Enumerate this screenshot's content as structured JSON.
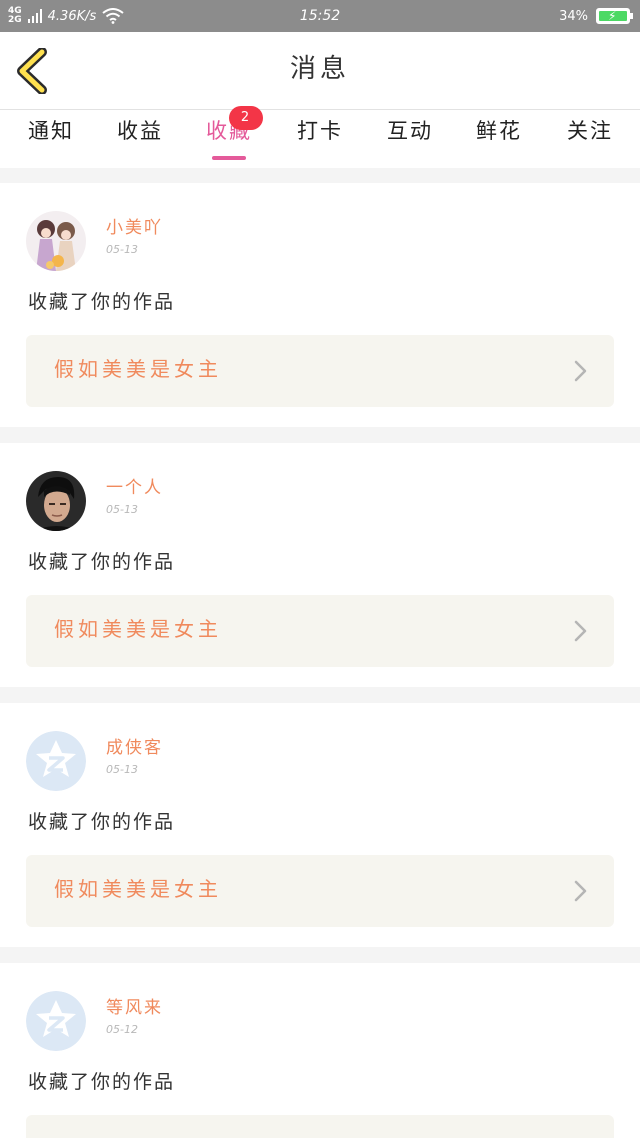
{
  "status_bar": {
    "network_top": "4G",
    "network_bottom": "2G",
    "speed": "4.36K/s",
    "time": "15:52",
    "battery": "34%"
  },
  "header": {
    "title": "消息",
    "back_icon": "chevron-left-icon"
  },
  "tabs": [
    {
      "label": "通知"
    },
    {
      "label": "收益"
    },
    {
      "label": "收藏",
      "badge": "2",
      "active": true
    },
    {
      "label": "打卡"
    },
    {
      "label": "互动"
    },
    {
      "label": "鲜花"
    },
    {
      "label": "关注"
    }
  ],
  "colors": {
    "accent_pink": "#e45a9a",
    "name_orange": "#f08a5d",
    "badge_red": "#f33547",
    "work_bg": "#f6f5ef"
  },
  "notifications": [
    {
      "name": "小美吖",
      "date": "05-13",
      "action": "收藏了你的作品",
      "work_title": "假如美美是女主",
      "avatar": "anime-girls-avatar"
    },
    {
      "name": "一个人",
      "date": "05-13",
      "action": "收藏了你的作品",
      "work_title": "假如美美是女主",
      "avatar": "man-photo-avatar"
    },
    {
      "name": "成侠客",
      "date": "05-13",
      "action": "收藏了你的作品",
      "work_title": "假如美美是女主",
      "avatar": "default-qq-avatar"
    },
    {
      "name": "等风来",
      "date": "05-12",
      "action": "收藏了你的作品",
      "work_title": "",
      "avatar": "default-qq-avatar"
    }
  ]
}
